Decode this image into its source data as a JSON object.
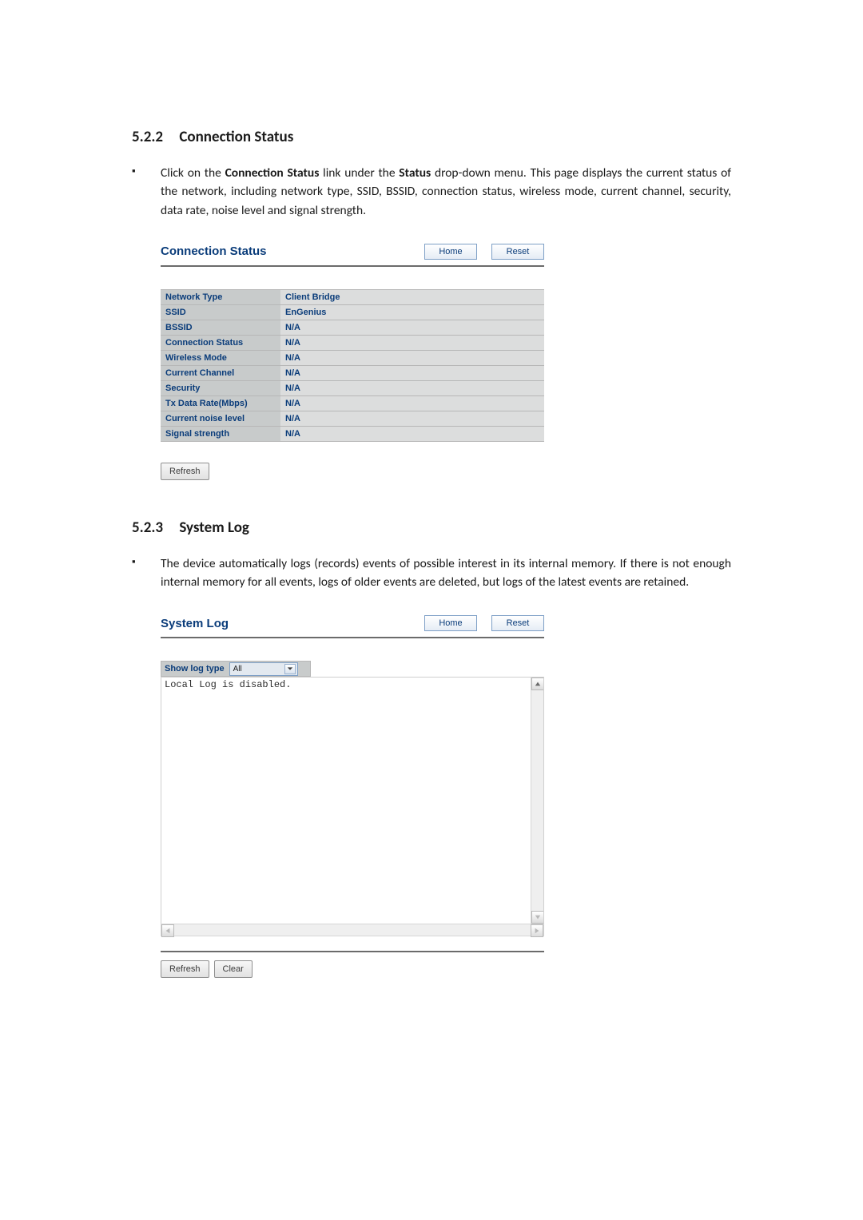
{
  "section1": {
    "number": "5.2.2",
    "title": "Connection Status",
    "bullet_pre": "Click on the ",
    "bullet_bold1": "Connection Status",
    "bullet_mid1": " link under the ",
    "bullet_bold2": "Status",
    "bullet_post": " drop-down menu. This page displays the current status of the network, including network type, SSID,  BSSID, connection status, wireless mode, current channel, security, data rate, noise level and signal strength."
  },
  "conn_panel": {
    "title": "Connection Status",
    "buttons": {
      "home": "Home",
      "reset": "Reset"
    },
    "rows": [
      {
        "label": "Network Type",
        "value": "Client Bridge"
      },
      {
        "label": "SSID",
        "value": "EnGenius"
      },
      {
        "label": "BSSID",
        "value": "N/A"
      },
      {
        "label": "Connection Status",
        "value": "N/A"
      },
      {
        "label": "Wireless Mode",
        "value": "N/A"
      },
      {
        "label": "Current Channel",
        "value": "N/A"
      },
      {
        "label": "Security",
        "value": "N/A"
      },
      {
        "label": "Tx Data Rate(Mbps)",
        "value": "N/A"
      },
      {
        "label": "Current noise level",
        "value": "N/A"
      },
      {
        "label": "Signal strength",
        "value": "N/A"
      }
    ],
    "refresh": "Refresh"
  },
  "section2": {
    "number": "5.2.3",
    "title": "System Log",
    "bullet": "The device automatically logs (records) events of possible interest in its internal memory. If there is not enough internal memory for all events, logs of older events are deleted, but logs of the latest events are retained."
  },
  "log_panel": {
    "title": "System Log",
    "buttons": {
      "home": "Home",
      "reset": "Reset"
    },
    "show_log_label": "Show log type",
    "show_log_value": "All",
    "log_text": "Local Log is disabled.",
    "refresh": "Refresh",
    "clear": "Clear"
  }
}
